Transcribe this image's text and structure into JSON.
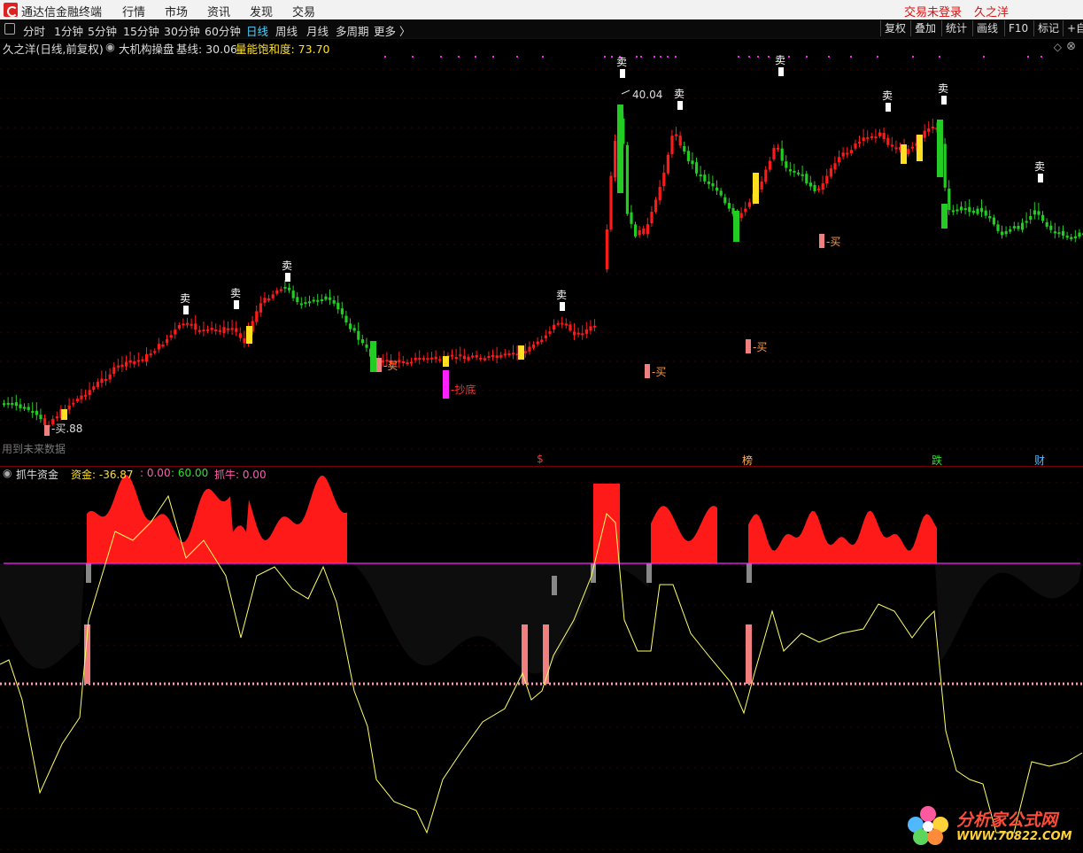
{
  "topbar": {
    "app_name": "通达信金融终端",
    "menu": [
      "行情",
      "市场",
      "资讯",
      "发现",
      "交易"
    ],
    "login_status": "交易未登录",
    "user_name": "久之洋"
  },
  "periods": {
    "tabs": [
      "分时",
      "1分钟",
      "5分钟",
      "15分钟",
      "30分钟",
      "60分钟",
      "日线",
      "周线",
      "月线",
      "多周期",
      "更多 〉"
    ],
    "active": "日线",
    "right_buttons": [
      "复权",
      "叠加",
      "统计",
      "画线",
      "F10",
      "标记",
      "+自"
    ]
  },
  "main_chart": {
    "stock_label": "久之洋(日线,前复权)",
    "indicator_name": "大机构操盘",
    "baseline_label": "基线: 30.06",
    "saturation_label": "量能饱和度: 73.70",
    "high_price": "40.04",
    "low_price": "27.88",
    "sell_label": "卖",
    "buy_label": "买",
    "bottom_label": "抄底",
    "future_data_note": "用到未来数据",
    "bottom_marks": [
      {
        "text": "$",
        "color": "#ff3030"
      },
      {
        "text": "榜",
        "color": "#ffb060"
      },
      {
        "text": "跌",
        "color": "#30e030"
      },
      {
        "text": "财",
        "color": "#4fb8ff"
      }
    ]
  },
  "sub_chart": {
    "indicator_name": "抓牛资金",
    "fund_label": "资金: -36.87",
    "zero_label": ": 0.00",
    "sixty_label": ": 60.00",
    "niu_label": "抓牛: 0.00"
  },
  "watermark": {
    "line1": "分析家公式网",
    "line2": "WWW.70822.COM"
  },
  "colors": {
    "up": "#ff1a1a",
    "down": "#22cc22",
    "yellow": "#ffe020",
    "pink": "#f08080",
    "magenta": "#ff20ff",
    "fund_line": "#ffff66"
  }
}
